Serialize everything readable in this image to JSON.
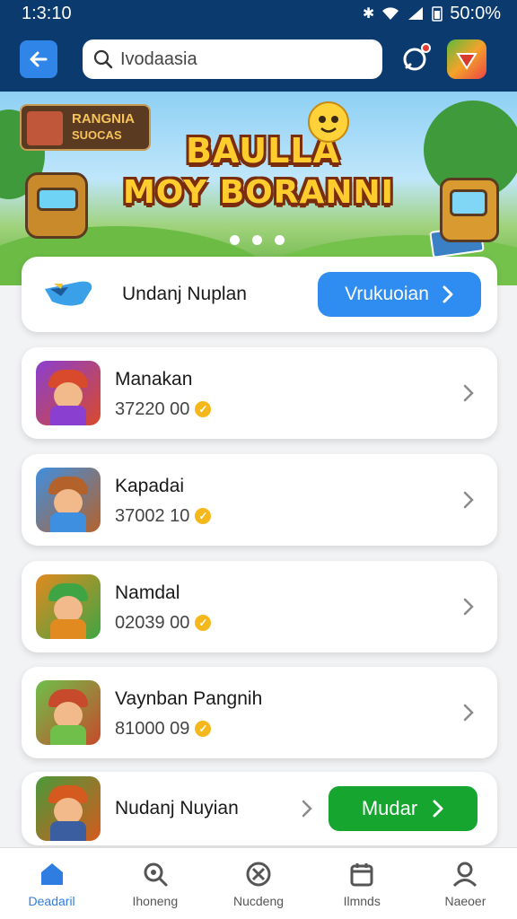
{
  "status_bar": {
    "time": "1:3:10",
    "battery": "50:0%"
  },
  "search": {
    "query": "Ivodaasia"
  },
  "banner": {
    "badge_line1": "RANGNIA",
    "badge_line2": "SUOCAS",
    "title_line1": "BAULLA",
    "title_line2": "MOY BORANNI",
    "slide_count": 3
  },
  "featured": {
    "label": "Undanj Nuplan",
    "button_label": "Vrukuoian"
  },
  "games": [
    {
      "name": "Manakan",
      "meta": "37220 00",
      "colors": [
        "#8b3fd0",
        "#d84a2b"
      ]
    },
    {
      "name": "Kapadai",
      "meta": "37002 10",
      "colors": [
        "#3f8fe0",
        "#b4622b"
      ]
    },
    {
      "name": "Namdal",
      "meta": "02039 00",
      "colors": [
        "#e08a1f",
        "#3fa544"
      ]
    },
    {
      "name": "Vaynban Pangnih",
      "meta": "81000 09",
      "colors": [
        "#6fbf4a",
        "#c64a2b"
      ]
    }
  ],
  "last_item": {
    "name": "Nudanj Nuyian",
    "button_label": "Mudar",
    "colors": [
      "#4a9a3a",
      "#d45a1f"
    ]
  },
  "bottom_nav": [
    {
      "label": "Deadaril",
      "icon": "home-icon",
      "active": true
    },
    {
      "label": "Ihoneng",
      "icon": "search-icon",
      "active": false
    },
    {
      "label": "Nucdeng",
      "icon": "game-icon",
      "active": false
    },
    {
      "label": "Ilmnds",
      "icon": "calendar-icon",
      "active": false
    },
    {
      "label": "Naeoer",
      "icon": "profile-icon",
      "active": false
    }
  ],
  "colors": {
    "header": "#0b3a6e",
    "accent_blue": "#2f8cf0",
    "accent_green": "#16a52f"
  }
}
